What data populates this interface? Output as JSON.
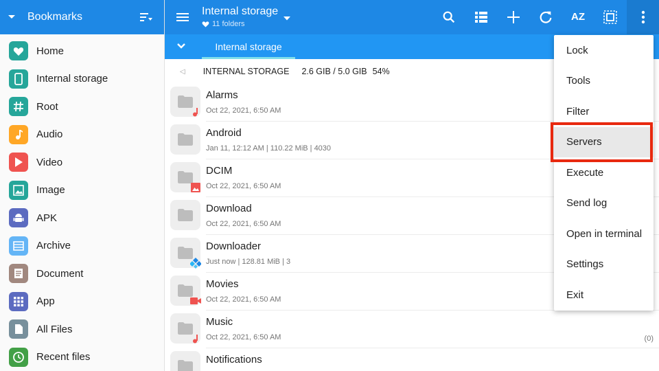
{
  "sidebar": {
    "title": "Bookmarks",
    "items": [
      {
        "label": "Home",
        "icon": "heart-icon",
        "color": "#26a69a"
      },
      {
        "label": "Internal storage",
        "icon": "phone-icon",
        "color": "#26a69a"
      },
      {
        "label": "Root",
        "icon": "hash-icon",
        "color": "#26a69a"
      },
      {
        "label": "Audio",
        "icon": "music-note-icon",
        "color": "#ffa726"
      },
      {
        "label": "Video",
        "icon": "play-icon",
        "color": "#ef5350"
      },
      {
        "label": "Image",
        "icon": "image-icon",
        "color": "#26a69a"
      },
      {
        "label": "APK",
        "icon": "android-icon",
        "color": "#5c6bc0"
      },
      {
        "label": "Archive",
        "icon": "archive-icon",
        "color": "#64b5f6"
      },
      {
        "label": "Document",
        "icon": "document-icon",
        "color": "#a1887f"
      },
      {
        "label": "App",
        "icon": "apps-grid-icon",
        "color": "#5c6bc0"
      },
      {
        "label": "All Files",
        "icon": "file-icon",
        "color": "#78909c"
      },
      {
        "label": "Recent files",
        "icon": "clock-icon",
        "color": "#43a047"
      }
    ]
  },
  "toolbar": {
    "title": "Internal storage",
    "subtitle": "11 folders",
    "sort_label": "AZ"
  },
  "tabs": [
    {
      "label": "Internal storage"
    }
  ],
  "pathbar": {
    "path": "INTERNAL STORAGE",
    "usage": "2.6 GIB / 5.0 GIB",
    "percent": "54%"
  },
  "files": [
    {
      "name": "Alarms",
      "meta": "Oct 22, 2021, 6:50 AM",
      "badge": "music-badge-icon",
      "count": ""
    },
    {
      "name": "Android",
      "meta": "Jan 11, 12:12 AM | 110.22 MiB | 4030",
      "badge": "",
      "count": ""
    },
    {
      "name": "DCIM",
      "meta": "Oct 22, 2021, 6:50 AM",
      "badge": "image-badge-icon",
      "count": ""
    },
    {
      "name": "Download",
      "meta": "Oct 22, 2021, 6:50 AM",
      "badge": "",
      "count": ""
    },
    {
      "name": "Downloader",
      "meta": "Just now | 128.81 MiB | 3",
      "badge": "kodi-badge-icon",
      "count": ""
    },
    {
      "name": "Movies",
      "meta": "Oct 22, 2021, 6:50 AM",
      "badge": "video-badge-icon",
      "count": ""
    },
    {
      "name": "Music",
      "meta": "Oct 22, 2021, 6:50 AM",
      "badge": "music-badge-icon",
      "count": "(0)"
    },
    {
      "name": "Notifications",
      "meta": "",
      "badge": "",
      "count": ""
    }
  ],
  "menu": {
    "items": [
      {
        "label": "Lock"
      },
      {
        "label": "Tools"
      },
      {
        "label": "Filter"
      },
      {
        "label": "Servers",
        "highlighted": true
      },
      {
        "label": "Execute"
      },
      {
        "label": "Send log"
      },
      {
        "label": "Open in terminal"
      },
      {
        "label": "Settings"
      },
      {
        "label": "Exit"
      }
    ]
  },
  "colors": {
    "primary": "#1e88e5",
    "tabbar": "#2196f3",
    "tab_indicator": "#80deea",
    "highlight": "#e8290f",
    "badge_red": "#ef5350"
  }
}
